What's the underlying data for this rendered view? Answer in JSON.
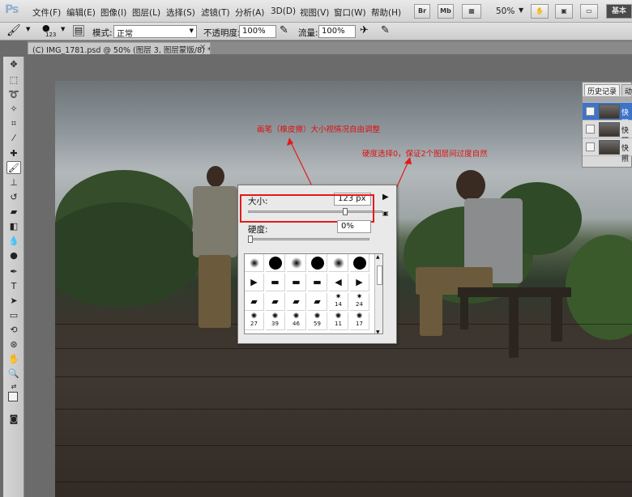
{
  "app": {
    "logo": "Ps"
  },
  "menu": [
    "文件(F)",
    "编辑(E)",
    "图像(I)",
    "图层(L)",
    "选择(S)",
    "滤镜(T)",
    "分析(A)",
    "3D(D)",
    "视图(V)",
    "窗口(W)",
    "帮助(H)"
  ],
  "menubar_right": {
    "br": "Br",
    "mb": "Mb",
    "zoom": "50%",
    "workspace": "基本"
  },
  "options": {
    "brush_size": "123",
    "mode_label": "模式:",
    "mode_value": "正常",
    "opacity_label": "不透明度:",
    "opacity_value": "100%",
    "flow_label": "流量:",
    "flow_value": "100%"
  },
  "document": {
    "tab_title": "(C) IMG_1781.psd @ 50% (图层 3, 图层蒙版/8) *",
    "close": "×"
  },
  "annotations": {
    "size_note": "画笔（橡皮擦）大小视情况自由调整",
    "hardness_note": "硬度选择0，保证2个图层间过度自然"
  },
  "brush_panel": {
    "size_label": "大小:",
    "size_value": "123 px",
    "size_level": 0.73,
    "hardness_label": "硬度:",
    "hardness_value": "0%",
    "hardness_level": 0.0,
    "preset_labels": [
      "14",
      "24",
      "27",
      "39",
      "46",
      "59",
      "11",
      "17"
    ]
  },
  "history": {
    "tab1": "历史记录",
    "tab2": "动作",
    "rows": [
      "快照",
      "快照",
      "快照"
    ]
  },
  "colors": {
    "accent_red": "#e21a1a",
    "selection_blue": "#3d74c9"
  }
}
